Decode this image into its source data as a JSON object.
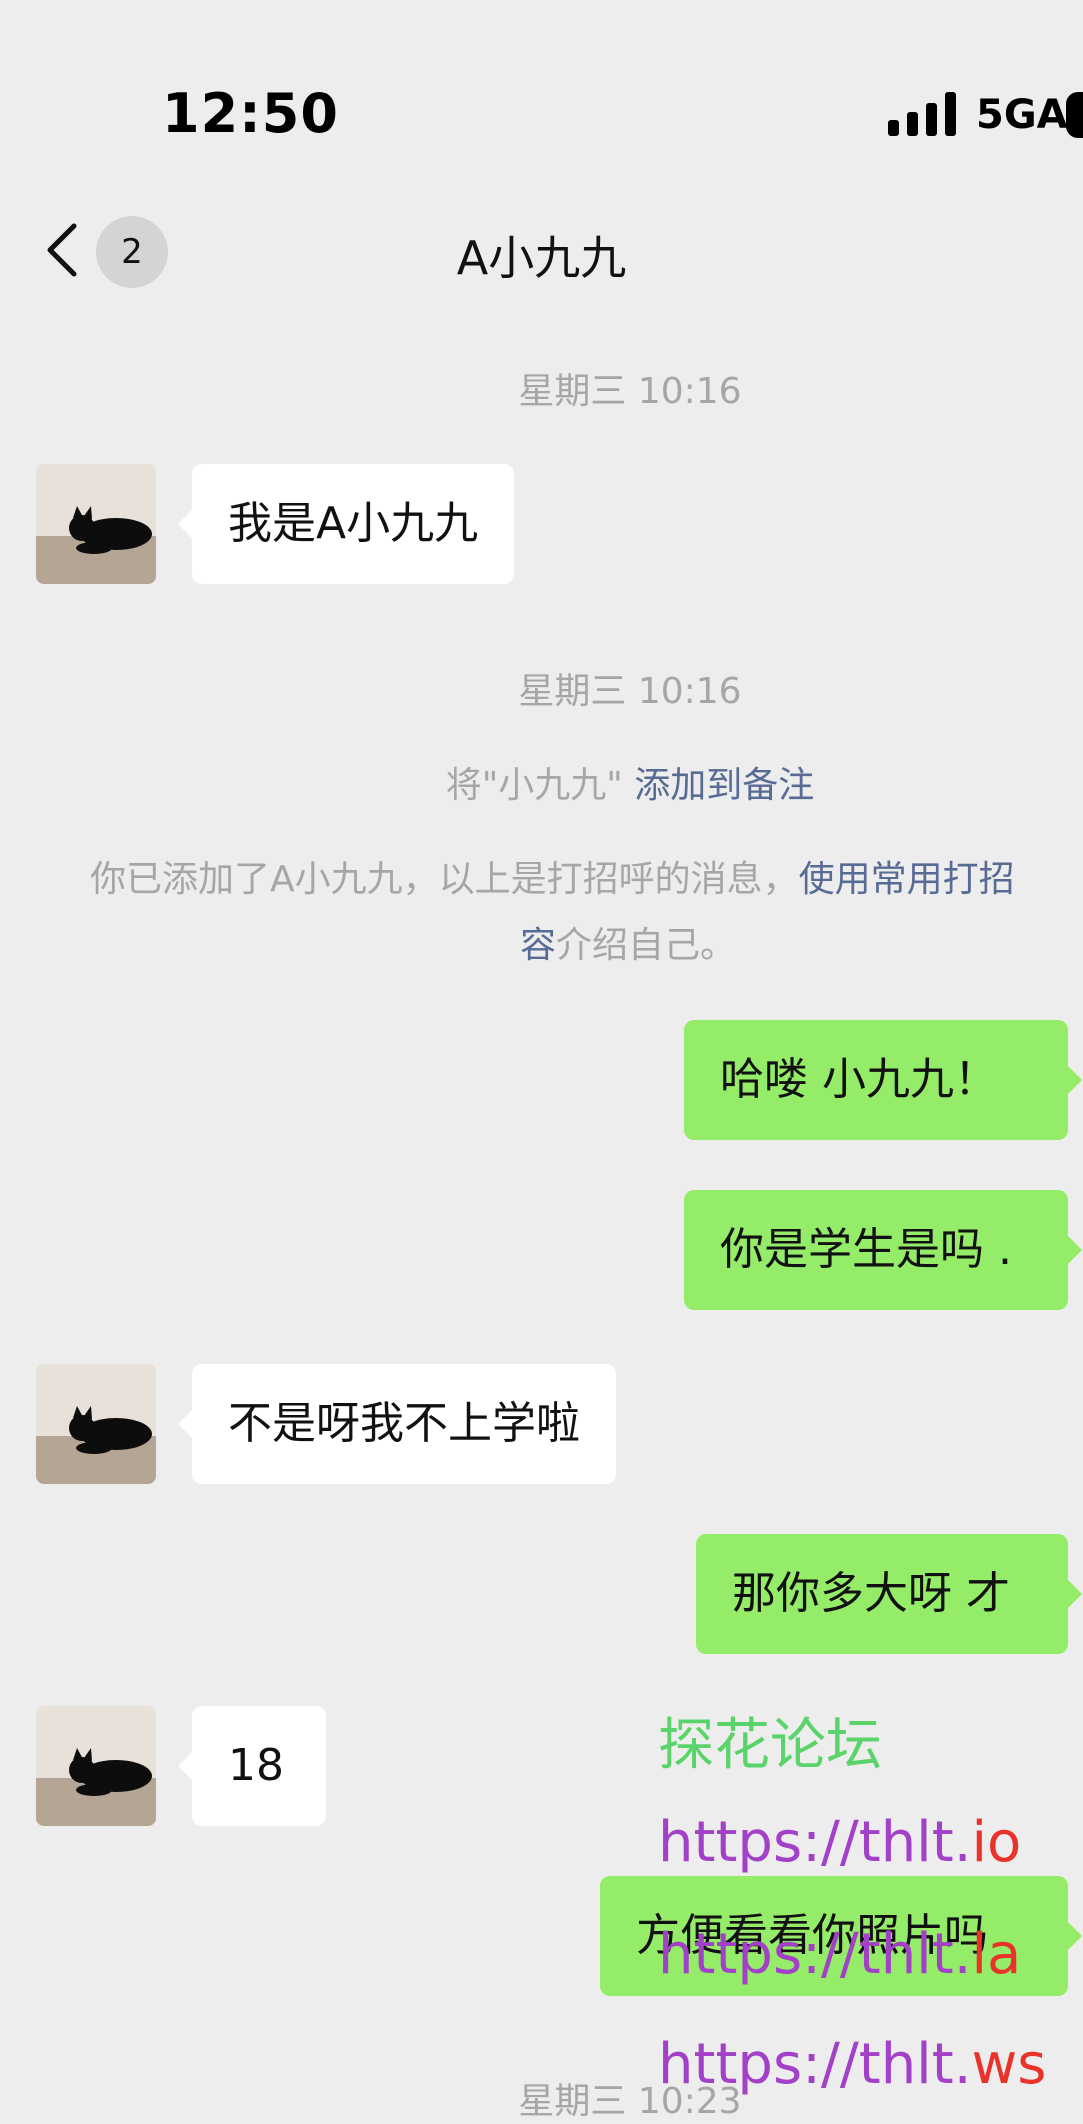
{
  "status_bar": {
    "time": "12:50",
    "network": "5GA"
  },
  "nav": {
    "unread_count": "2",
    "title": "A小九九"
  },
  "messages": {
    "ts1": "星期三 10:16",
    "m1": "我是A小九九",
    "ts2": "星期三 10:16",
    "remark_prefix": "将\"小九九\"",
    "remark_link": "添加到备注",
    "sys_text_1": "你已添加了A小九九，以上是打招呼的消息，",
    "sys_link_1": "使用常用打招",
    "sys_link_2": "容",
    "sys_text_2": "介绍自己。",
    "m2": "哈喽 小九九！",
    "m3": "你是学生是吗 .",
    "m4": "不是呀我不上学啦",
    "m5": "那你多大呀 才",
    "m6": "18",
    "m7": "方便看看你照片吗",
    "ts3": "星期三 10:23"
  },
  "watermark": {
    "title": "探花论坛",
    "url1_base": "https://thlt.",
    "url1_tld": "io",
    "url2_base": "https://thlt.",
    "url2_tld": "la",
    "url3_base": "https://thlt.",
    "url3_tld": "ws"
  },
  "colors": {
    "background": "#ededed",
    "sent_bubble": "#95ec69",
    "received_bubble": "#ffffff",
    "link": "#576b95",
    "system_text": "#a6a6a6"
  },
  "icons": {
    "back": "chevron-left-icon",
    "signal": "signal-bars-icon",
    "battery": "battery-icon",
    "avatar": "black-cat-photo"
  }
}
